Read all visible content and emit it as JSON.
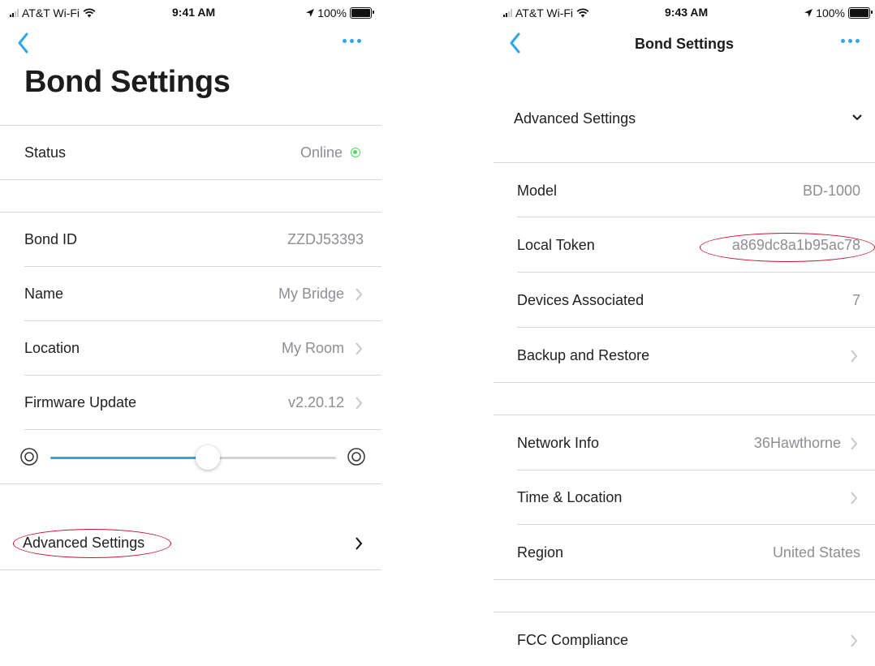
{
  "left": {
    "status_bar": {
      "carrier": "AT&T Wi-Fi",
      "time": "9:41 AM",
      "battery": "100%"
    },
    "title": "Bond Settings",
    "rows": {
      "status": {
        "label": "Status",
        "value": "Online"
      },
      "bond_id": {
        "label": "Bond ID",
        "value": "ZZDJ53393"
      },
      "name": {
        "label": "Name",
        "value": "My Bridge"
      },
      "location": {
        "label": "Location",
        "value": "My Room"
      },
      "firmware": {
        "label": "Firmware Update",
        "value": "v2.20.12"
      },
      "advanced": {
        "label": "Advanced Settings"
      }
    },
    "slider": {
      "level": 0.55
    }
  },
  "right": {
    "status_bar": {
      "carrier": "AT&T Wi-Fi",
      "time": "9:43 AM",
      "battery": "100%"
    },
    "nav_title": "Bond Settings",
    "advanced_header": "Advanced Settings",
    "rows": {
      "model": {
        "label": "Model",
        "value": "BD-1000"
      },
      "local_token": {
        "label": "Local Token",
        "value": "a869dc8a1b95ac78"
      },
      "devices": {
        "label": "Devices Associated",
        "value": "7"
      },
      "backup": {
        "label": "Backup and Restore"
      },
      "network": {
        "label": "Network Info",
        "value": "36Hawthorne"
      },
      "time_location": {
        "label": "Time & Location"
      },
      "region": {
        "label": "Region",
        "value": "United States"
      },
      "fcc": {
        "label": "FCC Compliance"
      }
    }
  },
  "colors": {
    "accent": "#2fa6e6",
    "online": "#4cd964",
    "annotation": "#c8102e",
    "secondary_text": "#8e8e93"
  }
}
